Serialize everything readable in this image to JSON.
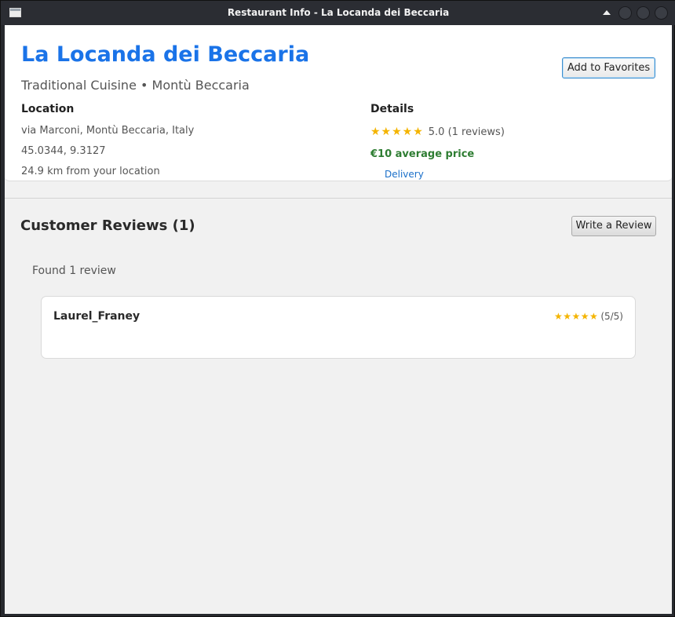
{
  "window": {
    "title": "Restaurant Info - La Locanda dei Beccaria"
  },
  "header": {
    "name": "La Locanda dei Beccaria",
    "subtitle": "Traditional Cuisine • Montù Beccaria",
    "favorite_label": "Add to Favorites"
  },
  "location": {
    "label": "Location",
    "address": "via Marconi, Montù Beccaria, Italy",
    "coordinates": "45.0344, 9.3127",
    "distance": "24.9 km from your location"
  },
  "details": {
    "label": "Details",
    "stars": "★★★★★",
    "rating_text": "5.0 (1 reviews)",
    "rating_value": 5.0,
    "price": "€10 average price",
    "delivery": "Delivery"
  },
  "reviews": {
    "heading": "Customer Reviews (1)",
    "write_label": "Write a Review",
    "found_text": "Found 1 review",
    "items": [
      {
        "author": "Laurel_Franey",
        "stars": "★★★★★",
        "score_text": "(5/5)"
      }
    ]
  },
  "colors": {
    "accent": "#1a73e8",
    "star": "#f4b400",
    "price": "#2e7d32",
    "link": "#1a6fc9"
  },
  "icons": {
    "app": "window-icon",
    "keep_above": "up-arrow-icon",
    "minimize": "circle-button-icon",
    "maximize": "circle-button-icon",
    "close": "circle-button-icon"
  }
}
